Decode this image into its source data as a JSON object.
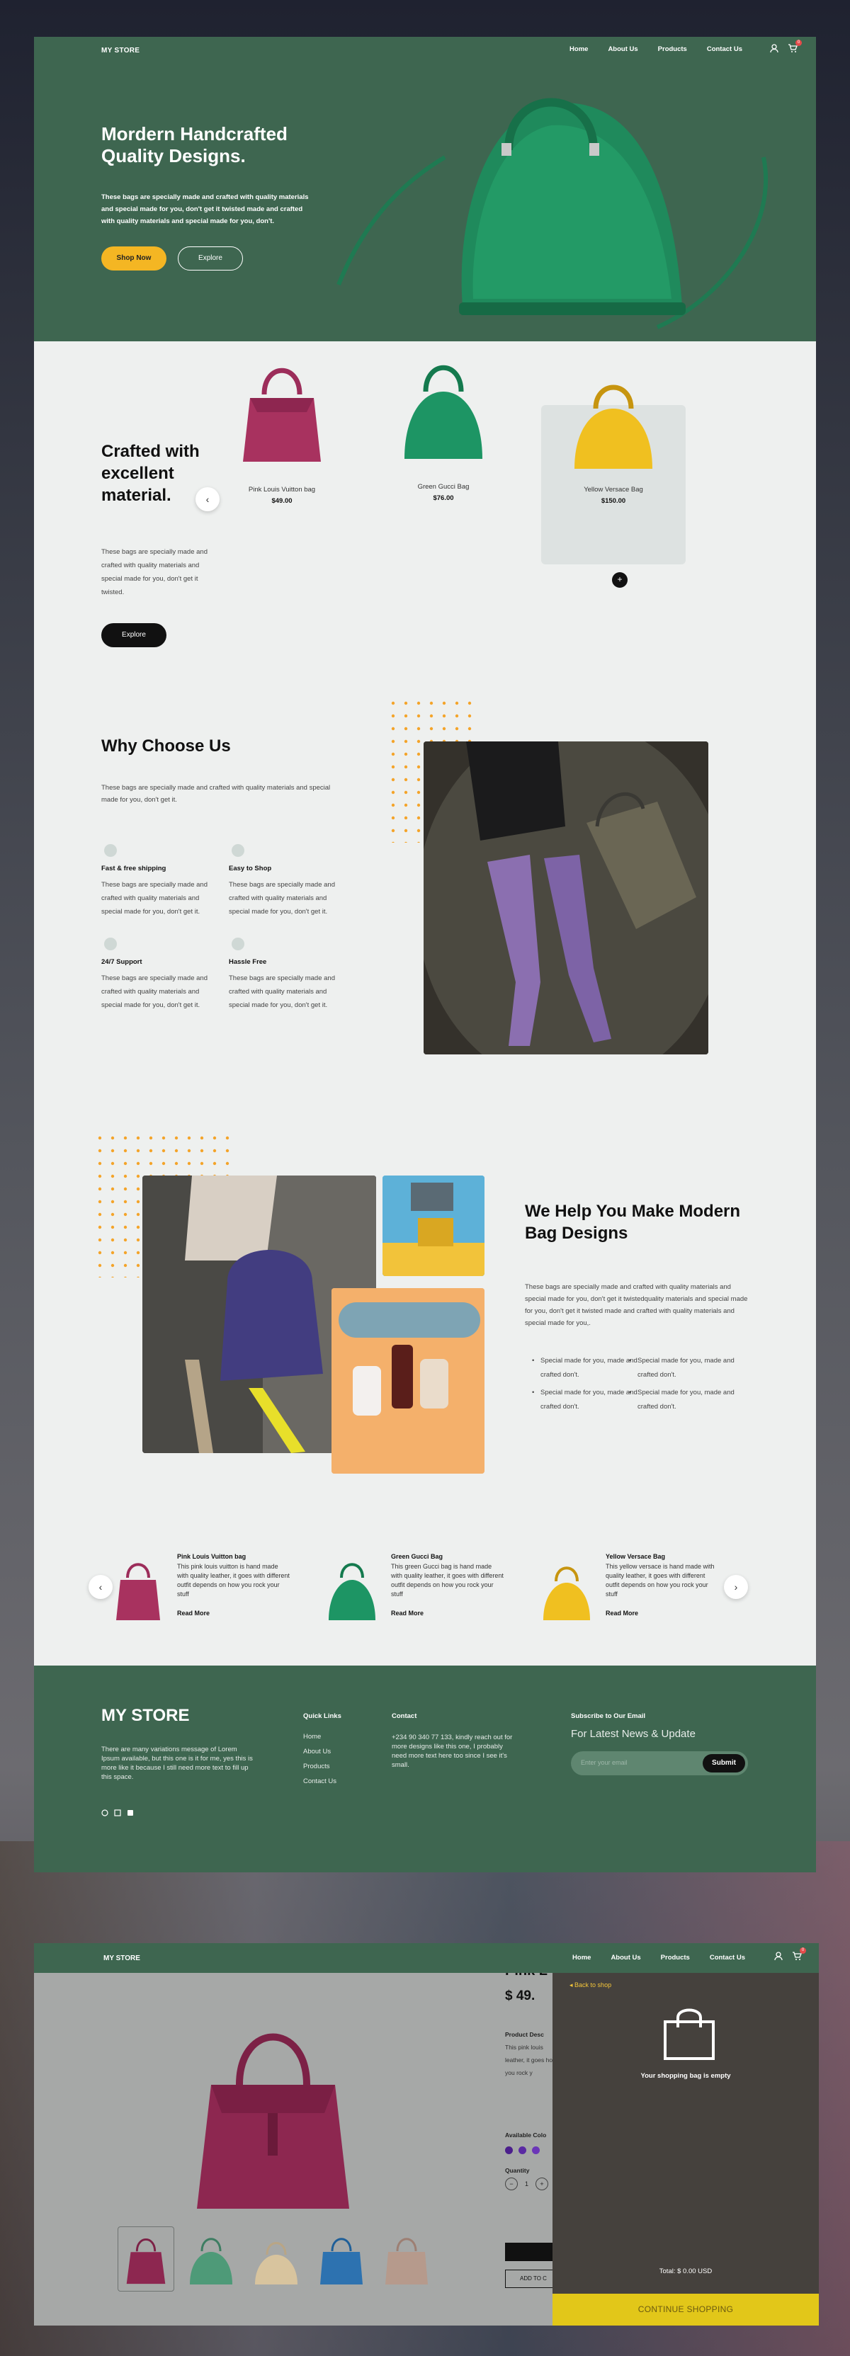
{
  "store": {
    "name": "MY STORE"
  },
  "nav": {
    "links": [
      "Home",
      "About Us",
      "Products",
      "Contact Us"
    ],
    "cart_count": "0"
  },
  "hero": {
    "title": "Mordern Handcrafted Quality Designs.",
    "text": "These bags are specially made and crafted with quality materials and special made for you, don't get it twisted made and crafted with quality materials and special made for you, don't.",
    "primary_button": "Shop Now",
    "secondary_button": "Explore"
  },
  "crafted": {
    "title": "Crafted with excellent material.",
    "text": "These bags are specially made and crafted with quality materials and special made for you, don't get it twisted.",
    "button": "Explore",
    "products": [
      {
        "name": "Pink Louis Vuitton bag",
        "price": "$49.00"
      },
      {
        "name": "Green Gucci Bag",
        "price": "$76.00"
      },
      {
        "name": "Yellow Versace Bag",
        "price": "$150.00"
      }
    ],
    "add_icon": "+"
  },
  "why": {
    "title": "Why Choose Us",
    "text": "These bags are specially made and crafted with quality materials and special made for you, don't get it.",
    "features": [
      {
        "title": "Fast & free shipping",
        "desc": "These bags are specially made and crafted with quality materials and special made for you, don't get it."
      },
      {
        "title": "Easy to Shop",
        "desc": "These bags are specially made and crafted with quality materials and special made for you, don't get it."
      },
      {
        "title": "24/7 Support",
        "desc": "These bags are specially made and crafted with quality materials and special made for you, don't get it."
      },
      {
        "title": "Hassle Free",
        "desc": "These bags are specially made and crafted with quality materials and special made for you, don't get it."
      }
    ]
  },
  "help": {
    "title": "We Help You Make Modern Bag Designs",
    "text": "These bags are specially made and crafted with quality materials and special made for you, don't get it twistedquality materials and special made for you, don't get it twisted made and crafted with quality materials and special made for you,.",
    "bullets": [
      "Special made for you, made and crafted don't.",
      "Special made for you, made and crafted don't.",
      "Special made for you, made and crafted don't.",
      "Special made for you, made and crafted don't."
    ]
  },
  "mini_products": [
    {
      "title": "Pink Louis Vuitton bag",
      "desc": "This pink louis vuitton is hand made with quality leather, it goes with different outfit depends on how you rock your stuff",
      "more": "Read More"
    },
    {
      "title": "Green Gucci Bag",
      "desc": "This green Gucci bag is hand made with quality leather, it goes with different outfit depends on how you rock your stuff",
      "more": "Read More"
    },
    {
      "title": "Yellow Versace Bag",
      "desc": "This yellow versace is hand made with quality leather, it goes with different outfit depends on how you rock your stuff",
      "more": "Read More"
    }
  ],
  "footer": {
    "brand": "MY STORE",
    "about": "There are many variations message of Lorem Ipsum available, but this one is it for me, yes this is more like it because I still need more text to fill up this space.",
    "quick_links_title": "Quick Links",
    "quick_links": [
      "Home",
      "About Us",
      "Products",
      "Contact Us"
    ],
    "contact_title": "Contact",
    "contact_text": "+234 90 340 77 133, kindly reach out for more designs like this one, I probably need more text here too since I see it's small.",
    "subscribe_title": "Subscribe to Our Email",
    "news_title": "For Latest News & Update",
    "email_placeholder": "Enter your email",
    "submit": "Submit"
  },
  "detail": {
    "title": "Pink L",
    "price": "$ 49.",
    "desc_label": "Product Desc",
    "desc": "This pink louis leather, it goes how you rock y",
    "colors_label": "Available Colo",
    "quantity_label": "Quantity",
    "quantity": "1",
    "add_to_cart": "ADD TO C",
    "colors": [
      "#4b1f8c",
      "#5a2aa3",
      "#6b36b8"
    ]
  },
  "cart": {
    "back": "Back to shop",
    "empty": "Your shopping bag is empty",
    "total": "Total: $ 0.00 USD",
    "continue": "CONTINUE SHOPPING"
  },
  "colors": {
    "brand_green": "#3e6650",
    "accent_yellow": "#f4b623",
    "cart_yellow": "#e2c719"
  }
}
